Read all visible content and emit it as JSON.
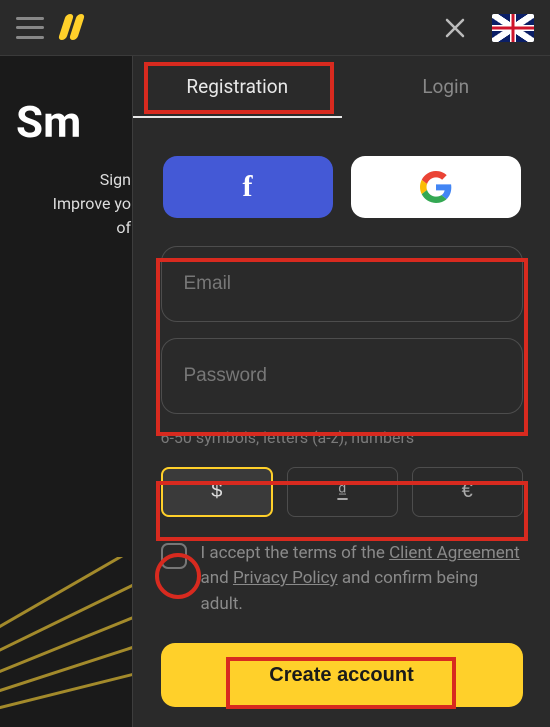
{
  "topbar": {
    "menu_icon": "hamburger",
    "logo": "brand-logo",
    "close_icon": "close",
    "language_flag": "uk"
  },
  "hero": {
    "title": "Sm",
    "line1": "Sign",
    "line2": "Improve yo",
    "line3": "of"
  },
  "tabs": {
    "registration": "Registration",
    "login": "Login",
    "active": "registration"
  },
  "social": {
    "facebook_glyph": "f",
    "google_label": "G"
  },
  "form": {
    "email_placeholder": "Email",
    "email_value": "",
    "password_placeholder": "Password",
    "password_value": "",
    "hint": "6-50 symbols, letters (a-z), numbers"
  },
  "currencies": {
    "options": [
      "$",
      "₫",
      "€"
    ],
    "selected_index": 0
  },
  "terms": {
    "checked": false,
    "prefix": "I accept the terms of the ",
    "client_agreement": "Client Agreement",
    "and1": " and ",
    "privacy_policy": "Privacy Policy",
    "suffix": " and confirm being adult."
  },
  "actions": {
    "create_account": "Create account"
  },
  "colors": {
    "brand_yellow": "#ffd02a",
    "facebook_blue": "#4459d6",
    "annotation_red": "#d82a1f"
  }
}
